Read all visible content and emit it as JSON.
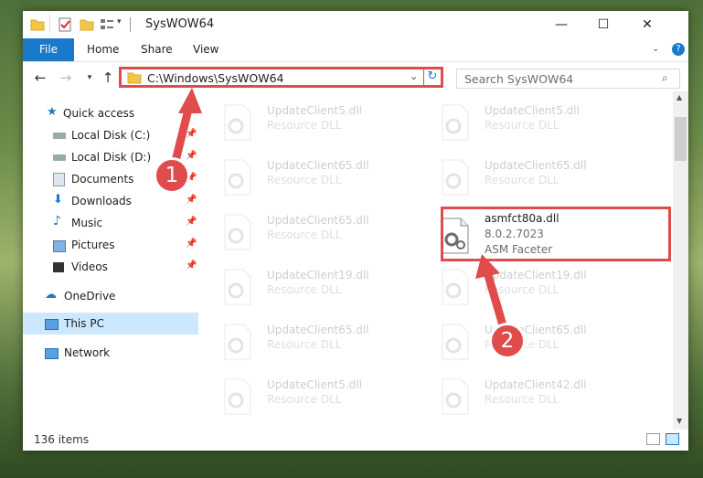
{
  "window": {
    "title": "SysWOW64",
    "controls": {
      "minimize": "—",
      "maximize": "☐",
      "close": "✕"
    }
  },
  "ribbon": {
    "tabs": [
      {
        "label": "File"
      },
      {
        "label": "Home"
      },
      {
        "label": "Share"
      },
      {
        "label": "View"
      }
    ]
  },
  "navigation": {
    "address": "C:\\Windows\\SysWOW64",
    "search_placeholder": "Search SysWOW64"
  },
  "sidebar": {
    "items": [
      {
        "label": "Quick access",
        "icon": "star-icon"
      },
      {
        "label": "Local Disk (C:)",
        "icon": "drive-icon",
        "pinned": true
      },
      {
        "label": "Local Disk (D:)",
        "icon": "drive-icon",
        "pinned": true
      },
      {
        "label": "Documents",
        "icon": "documents-icon",
        "pinned": true
      },
      {
        "label": "Downloads",
        "icon": "download-icon",
        "pinned": true
      },
      {
        "label": "Music",
        "icon": "music-icon",
        "pinned": true
      },
      {
        "label": "Pictures",
        "icon": "pictures-icon",
        "pinned": true
      },
      {
        "label": "Videos",
        "icon": "videos-icon",
        "pinned": true
      },
      {
        "label": "OneDrive",
        "icon": "cloud-icon"
      },
      {
        "label": "This PC",
        "icon": "computer-icon",
        "selected": true
      },
      {
        "label": "Network",
        "icon": "network-icon"
      }
    ]
  },
  "files": {
    "left_column": [
      {
        "name": "UpdateClient5.dll",
        "type": "Resource DLL"
      },
      {
        "name": "UpdateClient65.dll",
        "type": "Resource DLL"
      },
      {
        "name": "UpdateClient65.dll",
        "type": "Resource DLL"
      },
      {
        "name": "UpdateClient19.dll",
        "type": "Resource DLL"
      },
      {
        "name": "UpdateClient65.dll",
        "type": "Resource DLL"
      },
      {
        "name": "UpdateClient5.dll",
        "type": "Resource DLL"
      }
    ],
    "right_column": [
      {
        "name": "UpdateClient5.dll",
        "type": "Resource DLL"
      },
      {
        "name": "UpdateClient65.dll",
        "type": "Resource DLL"
      },
      {
        "name": "asmfct80a.dll",
        "version": "8.0.2.7023",
        "type": "ASM Faceter",
        "highlighted": true
      },
      {
        "name": "UpdateClient19.dll",
        "type": "Resource DLL"
      },
      {
        "name": "UpdateClient65.dll",
        "type": "Resource DLL"
      },
      {
        "name": "UpdateClient42.dll",
        "type": "Resource DLL"
      }
    ]
  },
  "status": {
    "item_count": "136 items"
  },
  "callouts": {
    "one": "1",
    "two": "2"
  },
  "colors": {
    "accent": "#1979ca",
    "highlight": "#e04b4b",
    "selected_bg": "#cce8ff"
  }
}
